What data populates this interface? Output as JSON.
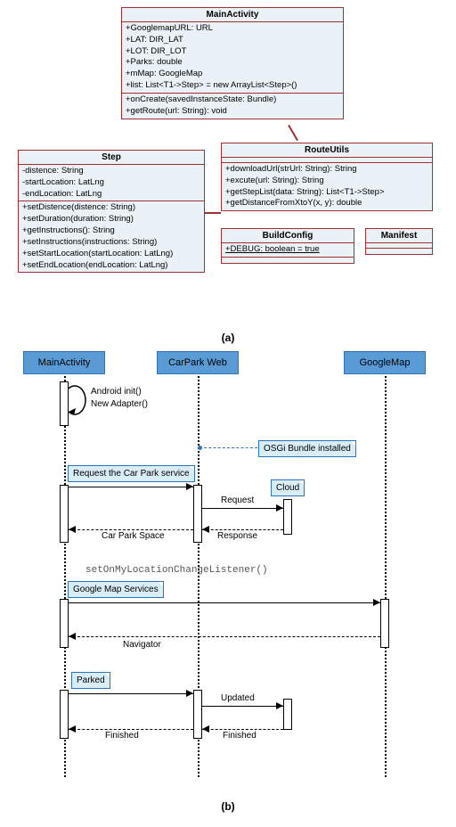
{
  "chart_data": [
    {
      "type": "uml-class-diagram",
      "classes": {
        "MainActivity": {
          "attributes": [
            "+GooglemapURL: URL",
            "+LAT: DIR_LAT",
            "+LOT: DIR_LOT",
            "+Parks: double",
            "+mMap: GoogleMap",
            "+list: List<T1->Step> = new ArrayList<Step>()"
          ],
          "operations": [
            "+onCreate(savedInstanceState: Bundle)",
            "+getRoute(url: String): void"
          ]
        },
        "Step": {
          "attributes": [
            "-distence: String",
            "-startLocation: LatLng",
            "-endLocation: LatLng"
          ],
          "operations": [
            "+setDistence(distence: String)",
            "+setDuration(duration: String)",
            "+getInstructions(): String",
            "+setInstructions(instructions: String)",
            "+setStartLocation(startLocation: LatLng)",
            "+setEndLocation(endLocation: LatLng)"
          ]
        },
        "RouteUtils": {
          "attributes": [],
          "operations": [
            "+downloadUrl(strUrl: String): String",
            "+excute(url: String): String",
            "+getStepList(data: String): List<T1->Step>",
            "+getDistanceFromXtoY(x, y): double"
          ]
        },
        "BuildConfig": {
          "attributes": [
            "+DEBUG: boolean = true"
          ],
          "operations": []
        },
        "Manifest": {
          "attributes": [],
          "operations": []
        }
      },
      "relations": [
        [
          "MainActivity",
          "RouteUtils"
        ],
        [
          "Step",
          "RouteUtils"
        ]
      ]
    },
    {
      "type": "uml-sequence-diagram",
      "lifelines": [
        "MainActivity",
        "CarPark Web",
        "GoogleMap"
      ],
      "notes": [
        "OSGi Bundle installed",
        "Request the Car Park service",
        "Cloud",
        "Google Map Services",
        "Parked"
      ],
      "messages": [
        {
          "kind": "self",
          "at": "MainActivity",
          "label": "Android init()\nNew Adapter()"
        },
        {
          "from": "MainActivity",
          "to": "CarPark Web",
          "label": "",
          "sync": true
        },
        {
          "from": "CarPark Web",
          "to": "Cloud",
          "label": "Request",
          "sync": true
        },
        {
          "from": "Cloud",
          "to": "CarPark Web",
          "label": "Response",
          "return": true
        },
        {
          "from": "CarPark Web",
          "to": "MainActivity",
          "label": "Car Park Space",
          "return": true
        },
        {
          "label": "setOnMyLocationChangeListener()"
        },
        {
          "from": "MainActivity",
          "to": "GoogleMap",
          "label": "",
          "sync": true
        },
        {
          "from": "GoogleMap",
          "to": "MainActivity",
          "label": "Navigator",
          "return": true
        },
        {
          "from": "MainActivity",
          "to": "CarPark Web",
          "label": "",
          "sync": true
        },
        {
          "from": "CarPark Web",
          "to": "Cloud",
          "label": "Updated",
          "sync": true
        },
        {
          "from": "Cloud",
          "to": "CarPark Web",
          "label": "Finished",
          "return": true
        },
        {
          "from": "CarPark Web",
          "to": "MainActivity",
          "label": "Finished",
          "return": true
        }
      ]
    }
  ],
  "classNames": {
    "main": "MainActivity",
    "step": "Step",
    "route": "RouteUtils",
    "build": "BuildConfig",
    "manifest": "Manifest"
  },
  "mainAttrs": {
    "0": "+GooglemapURL: URL",
    "1": "+LAT: DIR_LAT",
    "2": "+LOT: DIR_LOT",
    "3": "+Parks: double",
    "4": "+mMap: GoogleMap",
    "5": "+list: List<T1->Step> = new ArrayList<Step>()"
  },
  "mainOps": {
    "0": "+onCreate(savedInstanceState: Bundle)",
    "1": "+getRoute(url: String): void"
  },
  "stepAttrs": {
    "0": "-distence: String",
    "1": "-startLocation: LatLng",
    "2": "-endLocation: LatLng"
  },
  "stepOps": {
    "0": "+setDistence(distence: String)",
    "1": "+setDuration(duration: String)",
    "2": "+getInstructions(): String",
    "3": "+setInstructions(instructions: String)",
    "4": "+setStartLocation(startLocation: LatLng)",
    "5": "+setEndLocation(endLocation: LatLng)"
  },
  "routeOps": {
    "0": "+downloadUrl(strUrl: String): String",
    "1": "+excute(url: String): String",
    "2": "+getStepList(data: String): List<T1->Step>",
    "3": "+getDistanceFromXtoY(x, y): double"
  },
  "buildAttrs": {
    "0": "+DEBUG: boolean = true"
  },
  "captions": {
    "a": "(a)",
    "b": "(b)"
  },
  "seq": {
    "main": "MainActivity",
    "carpark": "CarPark Web",
    "gmap": "GoogleMap",
    "init1": "Android init()",
    "init2": "New Adapter()",
    "osgi": "OSGi Bundle installed",
    "reqsvc": "Request the Car Park service",
    "cloud": "Cloud",
    "request": "Request",
    "response": "Response",
    "cps": "Car Park Space",
    "listener": "setOnMyLocationChangeListener()",
    "gms": "Google Map Services",
    "nav": "Navigator",
    "parked": "Parked",
    "updated": "Updated",
    "fin1": "Finished",
    "fin2": "Finished"
  }
}
